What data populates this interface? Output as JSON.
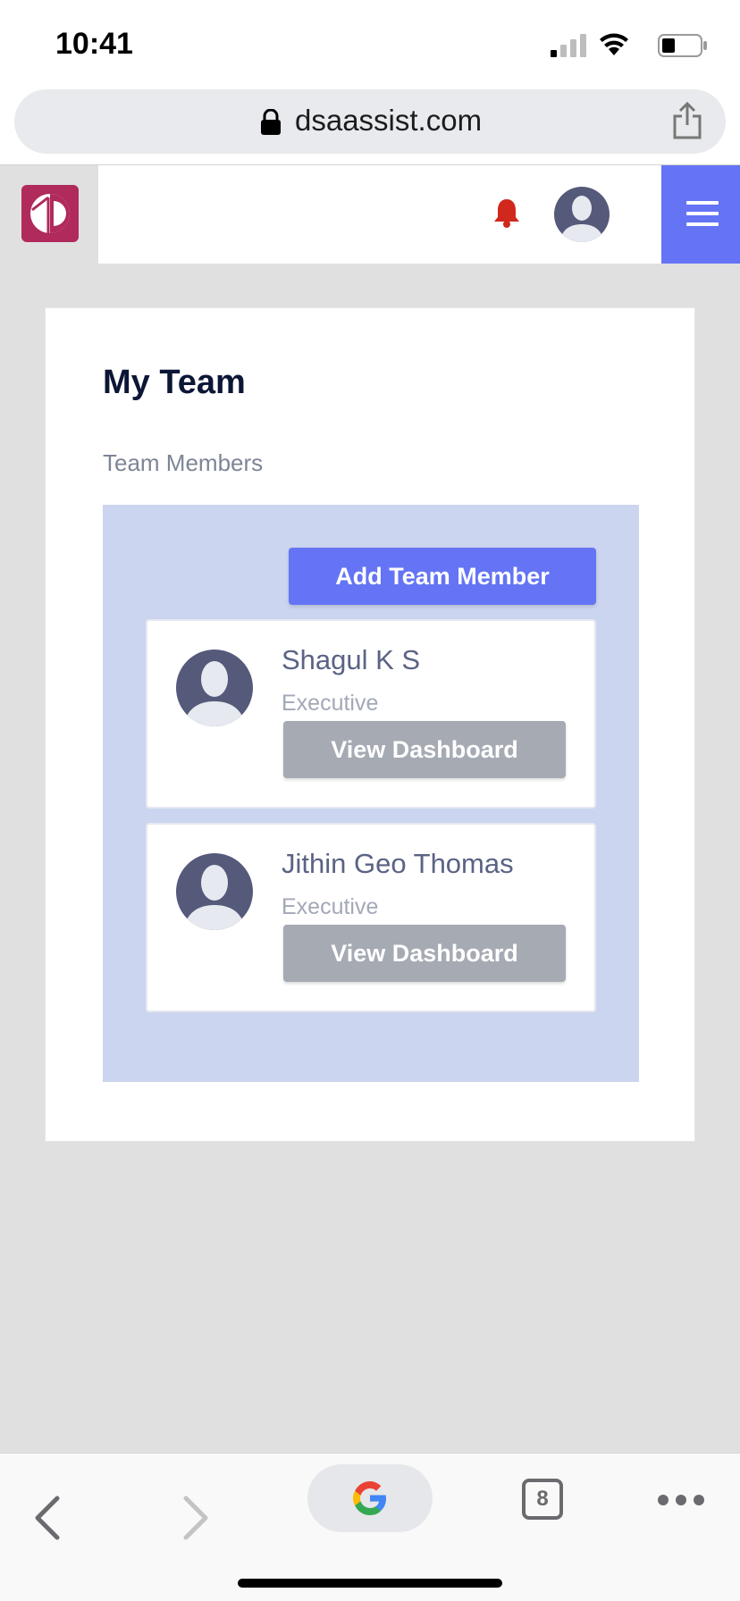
{
  "status_bar": {
    "time": "10:41"
  },
  "browser": {
    "url": "dsaassist.com",
    "tab_count": "8"
  },
  "header": {
    "logo": "dsa-logo",
    "notification_icon": "bell-icon",
    "avatar_icon": "user-avatar-icon",
    "menu_icon": "hamburger-icon"
  },
  "page": {
    "title": "My Team",
    "section_label": "Team Members",
    "add_button_label": "Add Team Member"
  },
  "members": [
    {
      "name": "Shagul K S",
      "role": "Executive",
      "button_label": "View Dashboard"
    },
    {
      "name": "Jithin Geo Thomas",
      "role": "Executive",
      "button_label": "View Dashboard"
    }
  ],
  "colors": {
    "accent": "#6474f4",
    "panel": "#ccd5ef",
    "button_gray": "#a5aab3",
    "bell": "#d0281c",
    "logo": "#b02a5c"
  }
}
